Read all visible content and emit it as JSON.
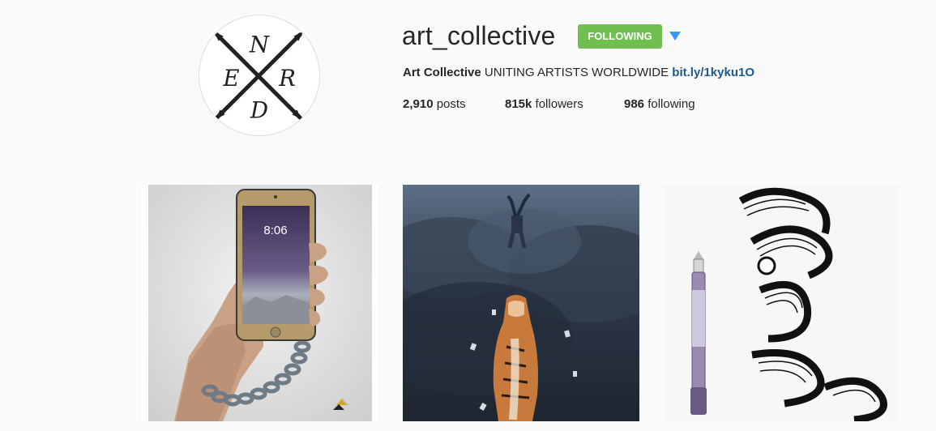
{
  "profile": {
    "username": "art_collective",
    "follow_button_label": "FOLLOWING",
    "full_name": "Art Collective",
    "bio": "UNITING ARTISTS WORLDWIDE",
    "link": "bit.ly/1kyku1O",
    "avatar_letters": {
      "top": "N",
      "left": "E",
      "right": "R",
      "bottom": "D"
    }
  },
  "stats": {
    "posts_count": "2,910",
    "posts_label": "posts",
    "followers_count": "815k",
    "followers_label": "followers",
    "following_count": "986",
    "following_label": "following"
  },
  "posts": [
    {
      "name": "hand-holding-phone-drawing",
      "phone_time": "8:06"
    },
    {
      "name": "tiger-and-falling-man-artwork"
    },
    {
      "name": "ink-ribbon-drawing-with-pen"
    }
  ],
  "colors": {
    "following_button": "#70c050",
    "dropdown_arrow": "#3897f0",
    "link": "#1d5a8a"
  },
  "icons": [
    "dropdown-arrow-icon"
  ]
}
